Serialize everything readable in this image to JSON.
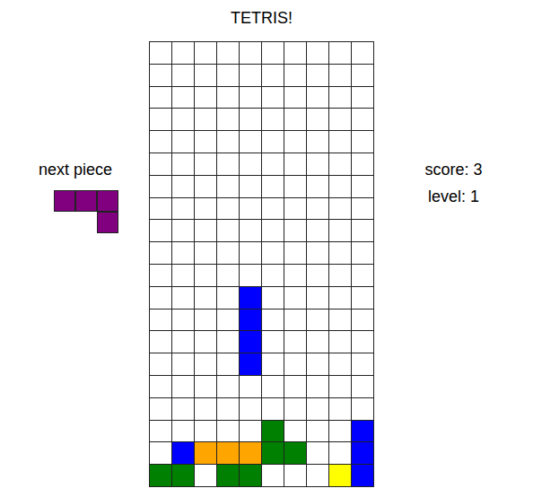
{
  "title": "TETRIS!",
  "next_piece": {
    "label": "next piece",
    "color": "#800080",
    "shape": [
      [
        1,
        1,
        1
      ],
      [
        0,
        0,
        1
      ]
    ]
  },
  "score": "score: 3",
  "level": "level: 1",
  "board": {
    "rows": [
      [
        "",
        "",
        "",
        "",
        "",
        "",
        "",
        "",
        "",
        ""
      ],
      [
        "",
        "",
        "",
        "",
        "",
        "",
        "",
        "",
        "",
        ""
      ],
      [
        "",
        "",
        "",
        "",
        "",
        "",
        "",
        "",
        "",
        ""
      ],
      [
        "",
        "",
        "",
        "",
        "",
        "",
        "",
        "",
        "",
        ""
      ],
      [
        "",
        "",
        "",
        "",
        "",
        "",
        "",
        "",
        "",
        ""
      ],
      [
        "",
        "",
        "",
        "",
        "",
        "",
        "",
        "",
        "",
        ""
      ],
      [
        "",
        "",
        "",
        "",
        "",
        "",
        "",
        "",
        "",
        ""
      ],
      [
        "",
        "",
        "",
        "",
        "",
        "",
        "",
        "",
        "",
        ""
      ],
      [
        "",
        "",
        "",
        "",
        "",
        "",
        "",
        "",
        "",
        ""
      ],
      [
        "",
        "",
        "",
        "",
        "",
        "",
        "",
        "",
        "",
        ""
      ],
      [
        "",
        "",
        "",
        "",
        "",
        "",
        "",
        "",
        "",
        ""
      ],
      [
        "",
        "",
        "",
        "",
        "#0000ff",
        "",
        "",
        "",
        "",
        ""
      ],
      [
        "",
        "",
        "",
        "",
        "#0000ff",
        "",
        "",
        "",
        "",
        ""
      ],
      [
        "",
        "",
        "",
        "",
        "#0000ff",
        "",
        "",
        "",
        "",
        ""
      ],
      [
        "",
        "",
        "",
        "",
        "#0000ff",
        "",
        "",
        "",
        "",
        ""
      ],
      [
        "",
        "",
        "",
        "",
        "",
        "",
        "",
        "",
        "",
        ""
      ],
      [
        "",
        "",
        "",
        "",
        "",
        "",
        "",
        "",
        "",
        ""
      ],
      [
        "",
        "",
        "",
        "",
        "",
        "#008000",
        "",
        "",
        "",
        "#0000ff"
      ],
      [
        "",
        "#0000ff",
        "#ffa500",
        "#ffa500",
        "#ffa500",
        "#008000",
        "#008000",
        "",
        "",
        "#0000ff"
      ],
      [
        "#008000",
        "#008000",
        "",
        "#008000",
        "#008000",
        "",
        "",
        "",
        "#ffff00",
        "#0000ff"
      ]
    ]
  }
}
